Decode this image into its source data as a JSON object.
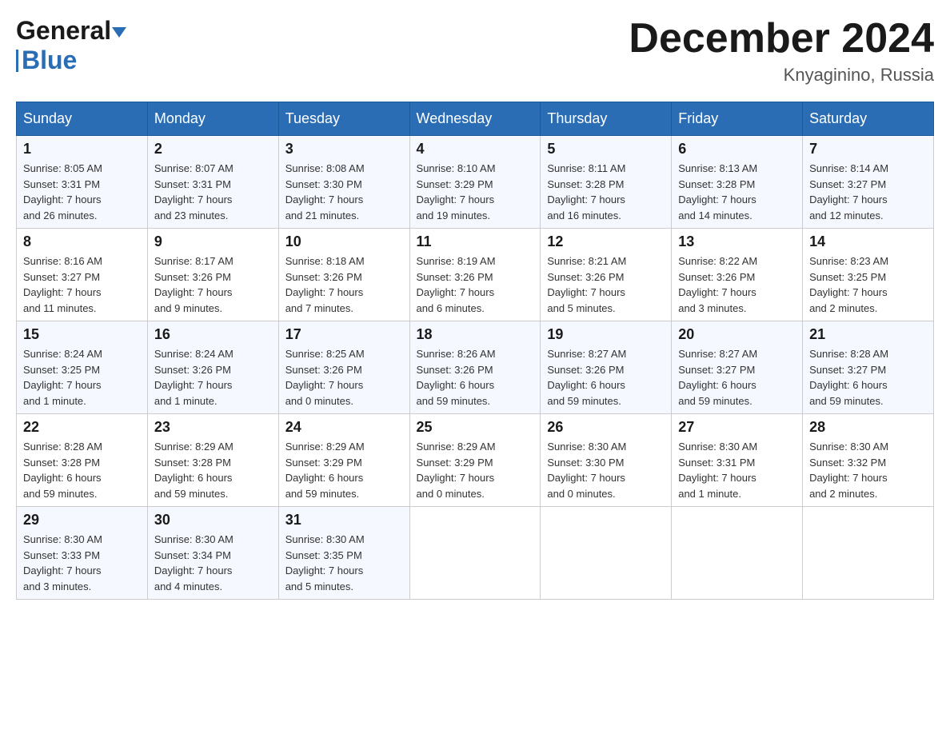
{
  "header": {
    "logo": {
      "general": "General",
      "blue": "Blue",
      "tagline": "GeneralBlue"
    },
    "title": "December 2024",
    "location": "Knyaginino, Russia"
  },
  "calendar": {
    "days_of_week": [
      "Sunday",
      "Monday",
      "Tuesday",
      "Wednesday",
      "Thursday",
      "Friday",
      "Saturday"
    ],
    "weeks": [
      [
        {
          "day": "1",
          "sunrise": "Sunrise: 8:05 AM",
          "sunset": "Sunset: 3:31 PM",
          "daylight": "Daylight: 7 hours and 26 minutes."
        },
        {
          "day": "2",
          "sunrise": "Sunrise: 8:07 AM",
          "sunset": "Sunset: 3:31 PM",
          "daylight": "Daylight: 7 hours and 23 minutes."
        },
        {
          "day": "3",
          "sunrise": "Sunrise: 8:08 AM",
          "sunset": "Sunset: 3:30 PM",
          "daylight": "Daylight: 7 hours and 21 minutes."
        },
        {
          "day": "4",
          "sunrise": "Sunrise: 8:10 AM",
          "sunset": "Sunset: 3:29 PM",
          "daylight": "Daylight: 7 hours and 19 minutes."
        },
        {
          "day": "5",
          "sunrise": "Sunrise: 8:11 AM",
          "sunset": "Sunset: 3:28 PM",
          "daylight": "Daylight: 7 hours and 16 minutes."
        },
        {
          "day": "6",
          "sunrise": "Sunrise: 8:13 AM",
          "sunset": "Sunset: 3:28 PM",
          "daylight": "Daylight: 7 hours and 14 minutes."
        },
        {
          "day": "7",
          "sunrise": "Sunrise: 8:14 AM",
          "sunset": "Sunset: 3:27 PM",
          "daylight": "Daylight: 7 hours and 12 minutes."
        }
      ],
      [
        {
          "day": "8",
          "sunrise": "Sunrise: 8:16 AM",
          "sunset": "Sunset: 3:27 PM",
          "daylight": "Daylight: 7 hours and 11 minutes."
        },
        {
          "day": "9",
          "sunrise": "Sunrise: 8:17 AM",
          "sunset": "Sunset: 3:26 PM",
          "daylight": "Daylight: 7 hours and 9 minutes."
        },
        {
          "day": "10",
          "sunrise": "Sunrise: 8:18 AM",
          "sunset": "Sunset: 3:26 PM",
          "daylight": "Daylight: 7 hours and 7 minutes."
        },
        {
          "day": "11",
          "sunrise": "Sunrise: 8:19 AM",
          "sunset": "Sunset: 3:26 PM",
          "daylight": "Daylight: 7 hours and 6 minutes."
        },
        {
          "day": "12",
          "sunrise": "Sunrise: 8:21 AM",
          "sunset": "Sunset: 3:26 PM",
          "daylight": "Daylight: 7 hours and 5 minutes."
        },
        {
          "day": "13",
          "sunrise": "Sunrise: 8:22 AM",
          "sunset": "Sunset: 3:26 PM",
          "daylight": "Daylight: 7 hours and 3 minutes."
        },
        {
          "day": "14",
          "sunrise": "Sunrise: 8:23 AM",
          "sunset": "Sunset: 3:25 PM",
          "daylight": "Daylight: 7 hours and 2 minutes."
        }
      ],
      [
        {
          "day": "15",
          "sunrise": "Sunrise: 8:24 AM",
          "sunset": "Sunset: 3:25 PM",
          "daylight": "Daylight: 7 hours and 1 minute."
        },
        {
          "day": "16",
          "sunrise": "Sunrise: 8:24 AM",
          "sunset": "Sunset: 3:26 PM",
          "daylight": "Daylight: 7 hours and 1 minute."
        },
        {
          "day": "17",
          "sunrise": "Sunrise: 8:25 AM",
          "sunset": "Sunset: 3:26 PM",
          "daylight": "Daylight: 7 hours and 0 minutes."
        },
        {
          "day": "18",
          "sunrise": "Sunrise: 8:26 AM",
          "sunset": "Sunset: 3:26 PM",
          "daylight": "Daylight: 6 hours and 59 minutes."
        },
        {
          "day": "19",
          "sunrise": "Sunrise: 8:27 AM",
          "sunset": "Sunset: 3:26 PM",
          "daylight": "Daylight: 6 hours and 59 minutes."
        },
        {
          "day": "20",
          "sunrise": "Sunrise: 8:27 AM",
          "sunset": "Sunset: 3:27 PM",
          "daylight": "Daylight: 6 hours and 59 minutes."
        },
        {
          "day": "21",
          "sunrise": "Sunrise: 8:28 AM",
          "sunset": "Sunset: 3:27 PM",
          "daylight": "Daylight: 6 hours and 59 minutes."
        }
      ],
      [
        {
          "day": "22",
          "sunrise": "Sunrise: 8:28 AM",
          "sunset": "Sunset: 3:28 PM",
          "daylight": "Daylight: 6 hours and 59 minutes."
        },
        {
          "day": "23",
          "sunrise": "Sunrise: 8:29 AM",
          "sunset": "Sunset: 3:28 PM",
          "daylight": "Daylight: 6 hours and 59 minutes."
        },
        {
          "day": "24",
          "sunrise": "Sunrise: 8:29 AM",
          "sunset": "Sunset: 3:29 PM",
          "daylight": "Daylight: 6 hours and 59 minutes."
        },
        {
          "day": "25",
          "sunrise": "Sunrise: 8:29 AM",
          "sunset": "Sunset: 3:29 PM",
          "daylight": "Daylight: 7 hours and 0 minutes."
        },
        {
          "day": "26",
          "sunrise": "Sunrise: 8:30 AM",
          "sunset": "Sunset: 3:30 PM",
          "daylight": "Daylight: 7 hours and 0 minutes."
        },
        {
          "day": "27",
          "sunrise": "Sunrise: 8:30 AM",
          "sunset": "Sunset: 3:31 PM",
          "daylight": "Daylight: 7 hours and 1 minute."
        },
        {
          "day": "28",
          "sunrise": "Sunrise: 8:30 AM",
          "sunset": "Sunset: 3:32 PM",
          "daylight": "Daylight: 7 hours and 2 minutes."
        }
      ],
      [
        {
          "day": "29",
          "sunrise": "Sunrise: 8:30 AM",
          "sunset": "Sunset: 3:33 PM",
          "daylight": "Daylight: 7 hours and 3 minutes."
        },
        {
          "day": "30",
          "sunrise": "Sunrise: 8:30 AM",
          "sunset": "Sunset: 3:34 PM",
          "daylight": "Daylight: 7 hours and 4 minutes."
        },
        {
          "day": "31",
          "sunrise": "Sunrise: 8:30 AM",
          "sunset": "Sunset: 3:35 PM",
          "daylight": "Daylight: 7 hours and 5 minutes."
        },
        null,
        null,
        null,
        null
      ]
    ]
  }
}
